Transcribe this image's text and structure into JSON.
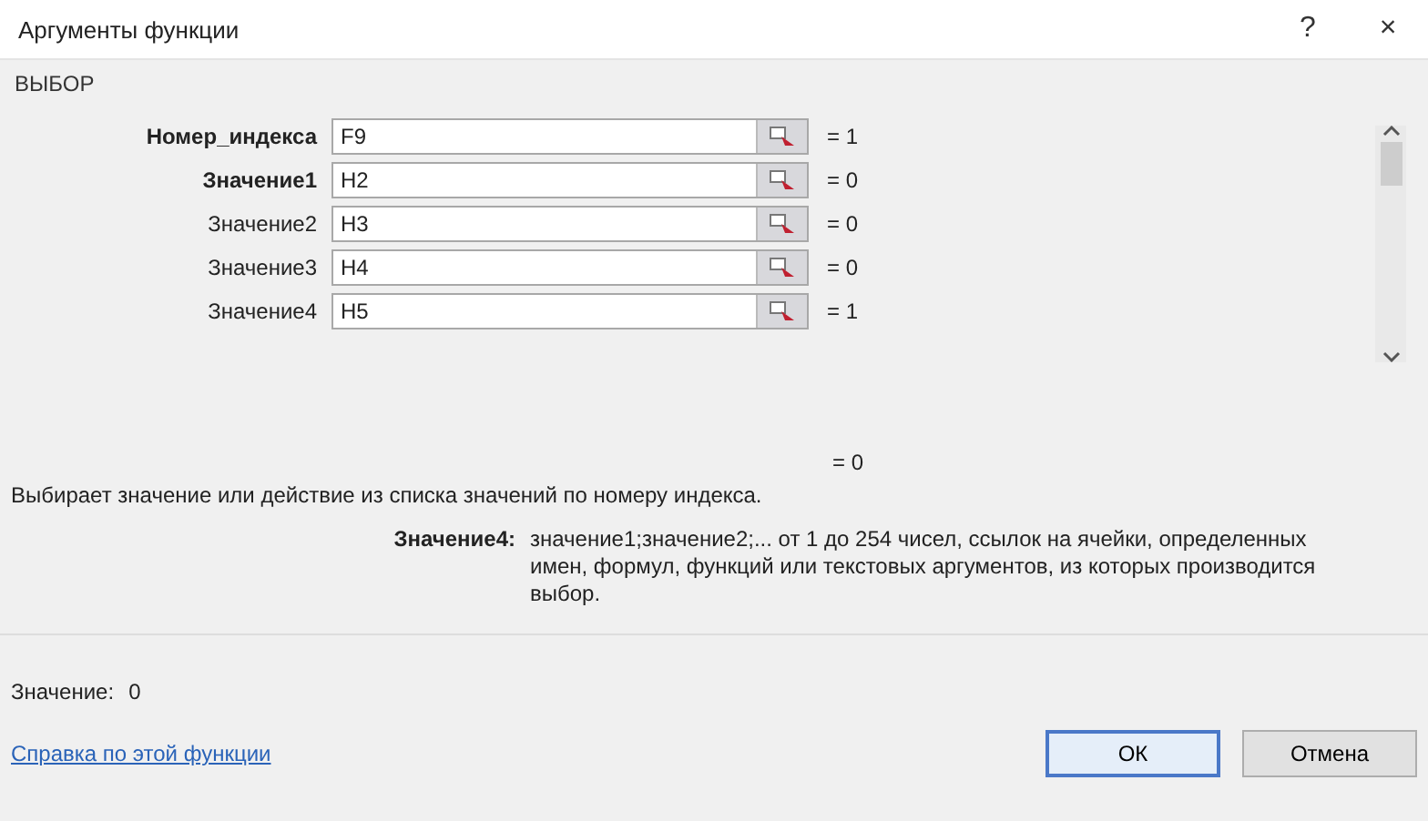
{
  "window": {
    "title": "Аргументы функции",
    "help": "?",
    "close": "×"
  },
  "function_name": "ВЫБОР",
  "arguments": [
    {
      "label": "Номер_индекса",
      "required": true,
      "value": "F9",
      "result": "= 1"
    },
    {
      "label": "Значение1",
      "required": true,
      "value": "H2",
      "result": "= 0"
    },
    {
      "label": "Значение2",
      "required": false,
      "value": "H3",
      "result": "= 0"
    },
    {
      "label": "Значение3",
      "required": false,
      "value": "H4",
      "result": "= 0"
    },
    {
      "label": "Значение4",
      "required": false,
      "value": "H5",
      "result": "= 1"
    }
  ],
  "formula_result": "= 0",
  "description": "Выбирает значение или действие из списка значений по номеру индекса.",
  "argument_help": {
    "label": "Значение4:",
    "text": "значение1;значение2;... от 1 до 254 чисел, ссылок на ячейки, определенных имен, формул, функций или текстовых аргументов, из которых производится выбор."
  },
  "value_line": {
    "label": "Значение:",
    "value": "0"
  },
  "help_link": "Справка по этой функции",
  "buttons": [
    {
      "label": "ОК",
      "kind": "default"
    },
    {
      "label": "Отмена",
      "kind": "normal"
    }
  ]
}
